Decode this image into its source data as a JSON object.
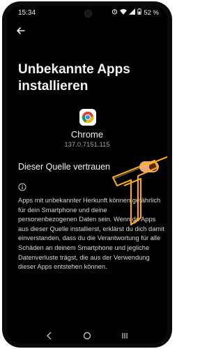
{
  "status_bar": {
    "time": "15:34",
    "battery": "52 %"
  },
  "page": {
    "title": "Unbekannte Apps installieren"
  },
  "app": {
    "name": "Chrome",
    "version": "137.0.7151.115",
    "icon": "chrome-icon"
  },
  "toggle": {
    "label": "Dieser Quelle vertrauen",
    "state": "on",
    "color": "#e8a77d"
  },
  "description": "Apps mit unbekannter Herkunft können gefährlich für dein Smartphone und deine personenbezogenen Daten sein. Wenn du Apps aus dieser Quelle installierst, erklärst du dich damit einverstanden, dass du die Verantwortung für alle Schäden an deinem Smartphone und jegliche Datenverluste trägst, die aus der Verwendung dieser Apps entstehen können.",
  "colors": {
    "background": "#000000",
    "accent": "#e8a77d",
    "highlight": "#ffb020"
  }
}
